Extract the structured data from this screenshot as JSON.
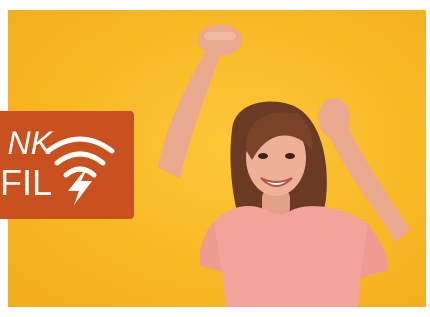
{
  "badge": {
    "line_top": "NK",
    "line_bottom": "FIL",
    "icon": "wifi-lightning-icon",
    "color": "#c9501f"
  },
  "photo": {
    "background_color": "#f8b824"
  }
}
